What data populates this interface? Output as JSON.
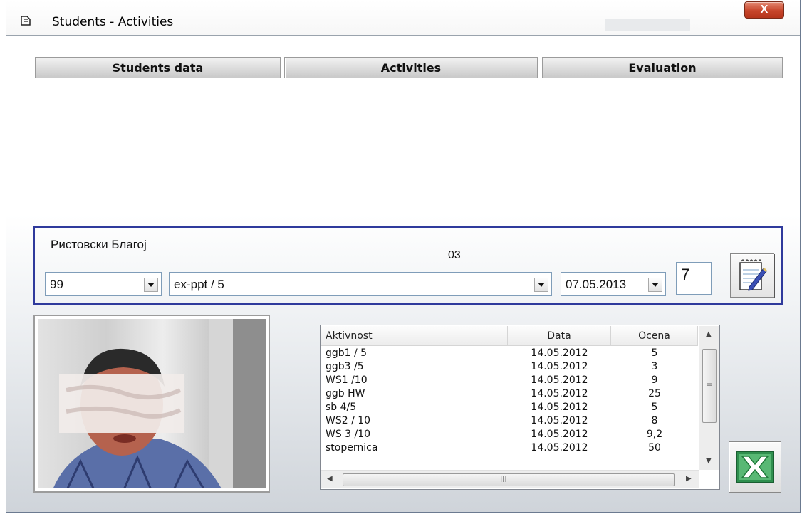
{
  "window": {
    "title": "Students  -  Activities",
    "close_label": "X"
  },
  "tabs": [
    {
      "label": "Students data"
    },
    {
      "label": "Activities"
    },
    {
      "label": "Evaluation"
    }
  ],
  "student": {
    "name": "Ристовски Благој",
    "group": "03"
  },
  "form": {
    "id_value": "99",
    "activity_value": "ex-ppt / 5",
    "date_value": "07.05.2013",
    "grade_value": "7"
  },
  "table": {
    "columns": [
      "Aktivnost",
      "Data",
      "Ocena"
    ],
    "rows": [
      {
        "activity": "ggb1 / 5",
        "date": "14.05.2012",
        "grade": "5"
      },
      {
        "activity": "ggb3 /5",
        "date": "14.05.2012",
        "grade": "3"
      },
      {
        "activity": "WS1 /10",
        "date": "14.05.2012",
        "grade": "9"
      },
      {
        "activity": "ggb HW",
        "date": "14.05.2012",
        "grade": "25"
      },
      {
        "activity": "sb 4/5",
        "date": "14.05.2012",
        "grade": "5"
      },
      {
        "activity": "WS2 / 10",
        "date": "14.05.2012",
        "grade": "8"
      },
      {
        "activity": "WS 3 /10",
        "date": "14.05.2012",
        "grade": "9,2"
      },
      {
        "activity": "stopernica",
        "date": "14.05.2012",
        "grade": "50"
      }
    ],
    "hscroll_grip": "III"
  },
  "colors": {
    "frame_border": "#2f3a9c",
    "close_red": "#c7452a",
    "excel_green": "#1f7a3a"
  },
  "icons": {
    "app": "app-icon",
    "save": "notepad-pen-icon",
    "export": "excel-icon"
  }
}
